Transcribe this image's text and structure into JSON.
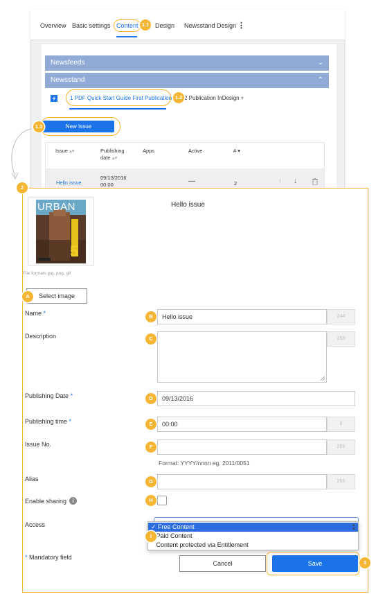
{
  "tabs": [
    "Overview",
    "Basic settings",
    "Content",
    "Design",
    "Newsstand Design"
  ],
  "accordion": {
    "newsfeeds": "Newsfeeds",
    "newsstand": "Newsstand"
  },
  "publication_tabs": [
    "1 PDF Quick Start Guide First Publication",
    "2 Publication InDesign"
  ],
  "new_issue_button": "New Issue",
  "table": {
    "headers": {
      "issue": "Issue",
      "publishing_date_1": "Publishing",
      "publishing_date_2": "date",
      "apps": "Apps",
      "active": "Active",
      "number": "#"
    },
    "row": {
      "issue": "Hello issue",
      "date": "09/13/2016",
      "time": "00:00",
      "active": "—",
      "number": "2"
    }
  },
  "callouts": {
    "c1_1": "1.1",
    "c1_2": "1.2",
    "c1_3": "1.3",
    "c2": "2",
    "cA": "A",
    "cB": "B",
    "cC": "C",
    "cD": "D",
    "cE": "E",
    "cF": "F",
    "cG": "G",
    "cH": "H",
    "cI": "I",
    "c3": "3"
  },
  "detail": {
    "title": "Hello issue",
    "cover": {
      "brand": "URBAN",
      "overlay": "5"
    },
    "file_formats": "File formats jpg, png, gif",
    "select_image": "Select image",
    "labels": {
      "name": "Name",
      "description": "Description",
      "publishing_date": "Publishing Date",
      "publishing_time": "Publishing time",
      "issue_no": "Issue No.",
      "alias": "Alias",
      "enable_sharing": "Enable sharing",
      "access": "Access",
      "mandatory": "Mandatory field"
    },
    "values": {
      "name": "Hello issue",
      "publishing_date": "09/13/2016",
      "publishing_time": "00:00"
    },
    "counters": {
      "name": "244",
      "description": "255",
      "time": "0",
      "issue_no": "255",
      "alias": "255"
    },
    "format_hint": "Format: YYYY/nnnn eg. 2011/0051",
    "access_options": [
      "Free Content",
      "Paid Content",
      "Content protected via Entitlement"
    ],
    "cancel": "Cancel",
    "save": "Save"
  },
  "colors": {
    "accent": "#1a73e8",
    "callout": "#f6b633",
    "accordion": "#8fabd6"
  }
}
